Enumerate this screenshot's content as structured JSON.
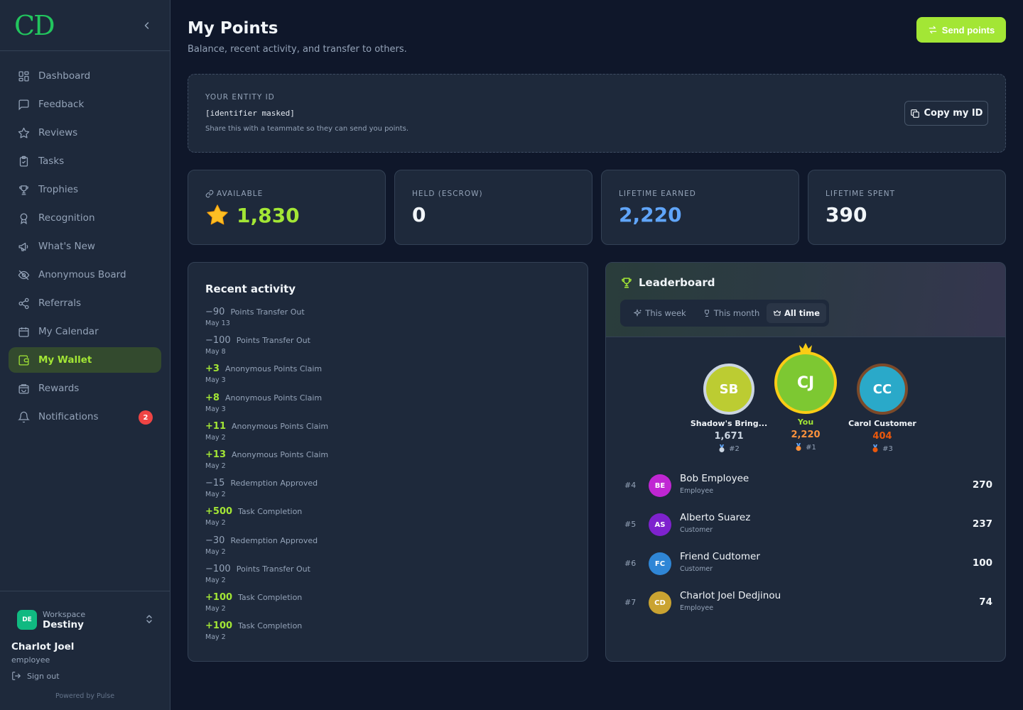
{
  "brand": {
    "logo": "CD"
  },
  "sidebar": {
    "items": [
      {
        "label": "Dashboard",
        "icon": "dashboard-icon"
      },
      {
        "label": "Feedback",
        "icon": "message-icon"
      },
      {
        "label": "Reviews",
        "icon": "star-icon"
      },
      {
        "label": "Tasks",
        "icon": "clipboard-check-icon"
      },
      {
        "label": "Trophies",
        "icon": "trophy-icon"
      },
      {
        "label": "Recognition",
        "icon": "award-icon"
      },
      {
        "label": "What's New",
        "icon": "megaphone-icon"
      },
      {
        "label": "Anonymous Board",
        "icon": "eye-off-icon"
      },
      {
        "label": "Referrals",
        "icon": "share-icon"
      },
      {
        "label": "My Calendar",
        "icon": "calendar-icon"
      },
      {
        "label": "My Wallet",
        "icon": "wallet-icon",
        "active": true
      },
      {
        "label": "Rewards",
        "icon": "shopping-bag-icon"
      },
      {
        "label": "Notifications",
        "icon": "bell-icon",
        "badge": "2"
      }
    ],
    "workspace": {
      "label": "Workspace",
      "name": "Destiny",
      "avatar": "DE"
    },
    "user": {
      "name": "Charlot Joel",
      "role": "employee"
    },
    "signout": "Sign out",
    "powered": "Powered by Pulse"
  },
  "header": {
    "title": "My Points",
    "subtitle": "Balance, recent activity, and transfer to others.",
    "send_label": "Send points"
  },
  "entity": {
    "label": "YOUR ENTITY ID",
    "value": "[identifier masked]",
    "hint": "Share this with a teammate so they can send you points.",
    "copy_label": "Copy my ID"
  },
  "stats": [
    {
      "label": "AVAILABLE",
      "value": "1,830",
      "color": "#a3e635"
    },
    {
      "label": "HELD (ESCROW)",
      "value": "0",
      "color": "#f1f5f9"
    },
    {
      "label": "LIFETIME EARNED",
      "value": "2,220",
      "color": "#60a5fa"
    },
    {
      "label": "LIFETIME SPENT",
      "value": "390",
      "color": "#f1f5f9"
    }
  ],
  "activity": {
    "title": "Recent activity",
    "items": [
      {
        "amount": "−90",
        "desc": "Points Transfer Out",
        "date": "May 13",
        "positive": false
      },
      {
        "amount": "−100",
        "desc": "Points Transfer Out",
        "date": "May 8",
        "positive": false
      },
      {
        "amount": "+3",
        "desc": "Anonymous Points Claim",
        "date": "May 3",
        "positive": true
      },
      {
        "amount": "+8",
        "desc": "Anonymous Points Claim",
        "date": "May 3",
        "positive": true
      },
      {
        "amount": "+11",
        "desc": "Anonymous Points Claim",
        "date": "May 2",
        "positive": true
      },
      {
        "amount": "+13",
        "desc": "Anonymous Points Claim",
        "date": "May 2",
        "positive": true
      },
      {
        "amount": "−15",
        "desc": "Redemption Approved",
        "date": "May 2",
        "positive": false
      },
      {
        "amount": "+500",
        "desc": "Task Completion",
        "date": "May 2",
        "positive": true
      },
      {
        "amount": "−30",
        "desc": "Redemption Approved",
        "date": "May 2",
        "positive": false
      },
      {
        "amount": "−100",
        "desc": "Points Transfer Out",
        "date": "May 2",
        "positive": false
      },
      {
        "amount": "+100",
        "desc": "Task Completion",
        "date": "May 2",
        "positive": true
      },
      {
        "amount": "+100",
        "desc": "Task Completion",
        "date": "May 2",
        "positive": true
      }
    ]
  },
  "leaderboard": {
    "title": "Leaderboard",
    "tabs": [
      "This week",
      "This month",
      "All time"
    ],
    "active_tab": "All time",
    "podium": [
      {
        "initials": "SB",
        "name": "Shadow's Bring...",
        "points": "1,671",
        "rank": "#2",
        "avatar_color": "#bccc32",
        "ring_color": "#cbd5e1",
        "points_color": "#cbd5e1"
      },
      {
        "initials": "CJ",
        "name": "You",
        "points": "2,220",
        "rank": "#1",
        "avatar_color": "#7dc832",
        "ring_color": "#facc15",
        "points_color": "#fb923c"
      },
      {
        "initials": "CC",
        "name": "Carol Customer",
        "points": "404",
        "rank": "#3",
        "avatar_color": "#2aa9c9",
        "ring_color": "#7c4a2a",
        "points_color": "#ea580c"
      }
    ],
    "rows": [
      {
        "rank": "#4",
        "initials": "BE",
        "name": "Bob Employee",
        "role": "Employee",
        "points": "270",
        "color": "#c026d3"
      },
      {
        "rank": "#5",
        "initials": "AS",
        "name": "Alberto Suarez",
        "role": "Customer",
        "points": "237",
        "color": "#7e22ce"
      },
      {
        "rank": "#6",
        "initials": "FC",
        "name": "Friend Cudtomer",
        "role": "Customer",
        "points": "100",
        "color": "#2f86d6"
      },
      {
        "rank": "#7",
        "initials": "CD",
        "name": "Charlot Joel Dedjinou",
        "role": "Employee",
        "points": "74",
        "color": "#caa331"
      }
    ]
  }
}
